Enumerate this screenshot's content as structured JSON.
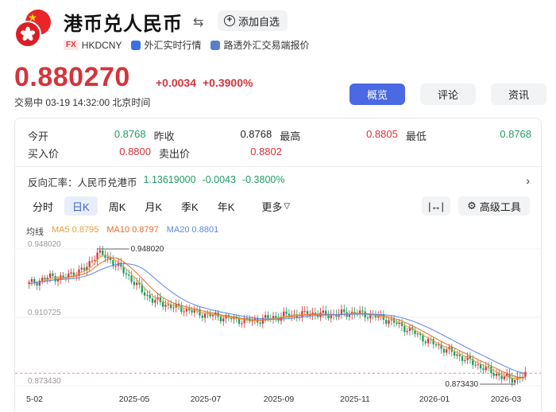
{
  "header": {
    "title": "港币兑人民币",
    "add_watch": "添加自选",
    "fx_badge": "FX",
    "code": "HKDCNY",
    "source1": "外汇实时行情",
    "source2": "路透外汇交易端报价"
  },
  "quote": {
    "price": "0.880270",
    "change_abs": "+0.0034",
    "change_pct": "+0.3900%",
    "status": "交易中  03-19 14:32:00 北京时间"
  },
  "tabs": [
    "概览",
    "评论",
    "资讯"
  ],
  "stats": {
    "open_label": "今开",
    "open": "0.8768",
    "prev_label": "昨收",
    "prev": "0.8768",
    "high_label": "最高",
    "high": "0.8805",
    "low_label": "最低",
    "low": "0.8768",
    "bid_label": "买入价",
    "bid": "0.8800",
    "ask_label": "卖出价",
    "ask": "0.8802"
  },
  "reverse": {
    "label": "反向汇率：人民币兑港币",
    "rate": "1.13619000",
    "change_abs": "-0.0043",
    "change_pct": "-0.3800%"
  },
  "periods": [
    "分时",
    "日K",
    "周K",
    "月K",
    "季K",
    "年K"
  ],
  "more_label": "更多",
  "advanced_tools": "高级工具",
  "ma": {
    "label": "均线",
    "ma5": "MA5 0.8795",
    "ma10": "MA10 0.8797",
    "ma20": "MA20 0.8801"
  },
  "colors": {
    "up": "#d4343b",
    "down": "#1f9d61",
    "accent": "#4a69e2",
    "ma5": "#e5a13a",
    "ma10": "#e46d2f",
    "ma20": "#5b86e5"
  },
  "chart_data": {
    "type": "candlestick",
    "y_ticks": [
      "0.948020",
      "0.910725",
      "0.873430"
    ],
    "ylim": [
      0.87343,
      0.94802
    ],
    "x_ticks": [
      "5-02",
      "2025-05",
      "2025-07",
      "2025-09",
      "2025-11",
      "2026-01",
      "2026-03"
    ],
    "max_label": "0.948020",
    "min_label": "0.873430",
    "last_value": 0.88027,
    "close_series": [
      0.929,
      0.931,
      0.933,
      0.932,
      0.935,
      0.937,
      0.946,
      0.943,
      0.938,
      0.932,
      0.925,
      0.92,
      0.918,
      0.916,
      0.915,
      0.913,
      0.912,
      0.911,
      0.91,
      0.909,
      0.909,
      0.91,
      0.911,
      0.912,
      0.912,
      0.913,
      0.912,
      0.912,
      0.913,
      0.913,
      0.912,
      0.911,
      0.909,
      0.906,
      0.903,
      0.899,
      0.896,
      0.893,
      0.89,
      0.887,
      0.884,
      0.881,
      0.878,
      0.877,
      0.879
    ]
  }
}
